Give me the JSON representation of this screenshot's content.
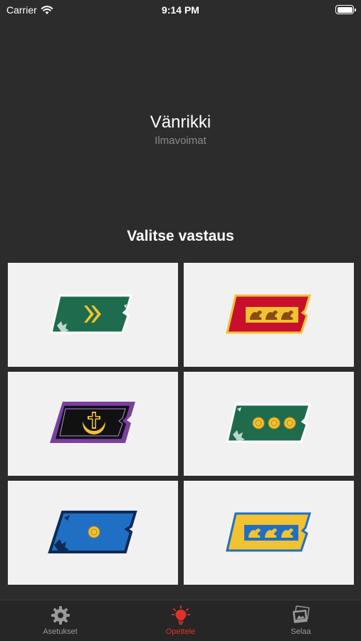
{
  "status_bar": {
    "carrier": "Carrier",
    "time": "9:14 PM",
    "battery_level": 1.0
  },
  "question": {
    "rank": "Vänrikki",
    "branch": "Ilmavoimat",
    "prompt": "Valitse vastaus"
  },
  "answers": [
    {
      "background": "#1e6b4e",
      "border": "#ffffff",
      "insignia": "chevrons",
      "insignia_color": "#f2c230"
    },
    {
      "background": "#c8102e",
      "border": "#f2c230",
      "insignia": "lions",
      "insignia_count": 3
    },
    {
      "background": "#111111",
      "border": "#7a3fa0",
      "insignia": "cross-wreath",
      "insignia_color": "#f2c230"
    },
    {
      "background": "#1e6b4e",
      "border": "#ffffff",
      "insignia": "rosettes",
      "insignia_count": 3
    },
    {
      "background": "#1f6fc4",
      "border": "#0d2a55",
      "insignia": "rosettes",
      "insignia_count": 1
    },
    {
      "background": "#f2c230",
      "border": "#1f6fc4",
      "insignia": "lions",
      "insignia_count": 3
    }
  ],
  "tab_bar": {
    "tabs": [
      {
        "label": "Asetukset",
        "icon": "gear-icon",
        "active": false
      },
      {
        "label": "Opettele",
        "icon": "lightbulb-icon",
        "active": true
      },
      {
        "label": "Selaa",
        "icon": "photos-icon",
        "active": false
      }
    ],
    "active_color": "#e0322a"
  }
}
